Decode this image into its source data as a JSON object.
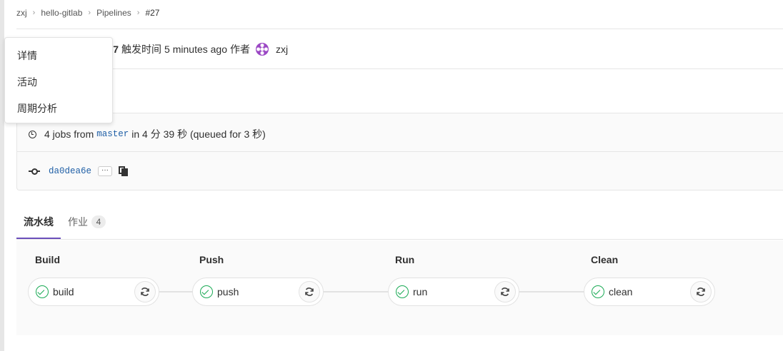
{
  "breadcrumb": {
    "items": [
      "zxj",
      "hello-gitlab",
      "Pipelines",
      "#27"
    ],
    "separator": "›"
  },
  "header": {
    "title_fragment": "e #27",
    "triggered_label": "触发时间",
    "time_ago": "5 minutes ago",
    "author_label": "作者",
    "author_name": "zxj"
  },
  "dropdown": {
    "items": [
      "详情",
      "活动",
      "周期分析"
    ]
  },
  "pipeline_info": {
    "jobs_prefix": "4 jobs from",
    "branch": "master",
    "duration_text": "in 4 分 39 秒 (queued for 3 秒)",
    "commit_sha": "da0dea6e",
    "ellipsis": "···"
  },
  "tabs": [
    {
      "label": "流水线",
      "active": true
    },
    {
      "label": "作业",
      "count": "4",
      "active": false
    }
  ],
  "stages": [
    {
      "title": "Build",
      "job": "build",
      "status": "success"
    },
    {
      "title": "Push",
      "job": "push",
      "status": "success"
    },
    {
      "title": "Run",
      "job": "run",
      "status": "success"
    },
    {
      "title": "Clean",
      "job": "clean",
      "status": "success"
    }
  ],
  "colors": {
    "success": "#1aaa55",
    "tab_active": "#6b4fbb",
    "link": "#1f5fa6",
    "avatar": "#9b47c4"
  },
  "icons": {
    "status": "check-circle-icon",
    "retry": "retry-icon",
    "clock": "clock-icon",
    "commit": "commit-icon",
    "copy": "copy-icon"
  }
}
